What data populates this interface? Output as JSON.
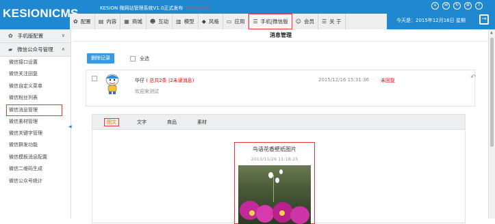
{
  "header": {
    "logo": "KESIONICMS",
    "system_name": "KESION 微网站管理系统V1.0正式发布",
    "system_highlight": "2015/2/15",
    "today": "今天是：2015年12月16日 星期",
    "nav": [
      {
        "icon": "gear-icon",
        "glyph": "✿",
        "label": "配置"
      },
      {
        "icon": "document-icon",
        "glyph": "▤",
        "label": "内容"
      },
      {
        "icon": "shop-icon",
        "glyph": "▦",
        "label": "商城"
      },
      {
        "icon": "people-icon",
        "glyph": "☻",
        "label": "互动"
      },
      {
        "icon": "grid-icon",
        "glyph": "▥",
        "label": "模型"
      },
      {
        "icon": "tag-icon",
        "glyph": "◆",
        "label": "风格"
      },
      {
        "icon": "monitor-icon",
        "glyph": "▭",
        "label": "应用"
      },
      {
        "icon": "menu-icon",
        "glyph": "☰",
        "label": "手机|微信版"
      },
      {
        "icon": "user-icon",
        "glyph": "☺",
        "label": "会员"
      },
      {
        "icon": "menu-icon",
        "glyph": "☰",
        "label": "关 于"
      }
    ],
    "active_nav": 7
  },
  "sidebar": {
    "sections": [
      {
        "icon": "gear-icon",
        "label": "手机版配置",
        "chevron": "∨"
      },
      {
        "icon": "chat-icon",
        "label": "微信公众号管理",
        "chevron": "∧"
      }
    ],
    "items": [
      "微信接口设置",
      "微信关注回复",
      "微信自定义菜单",
      "微信粉丝列表",
      "微信消息管理",
      "微信素材管理",
      "微信关键字管理",
      "微信群发功能",
      "微信模板消息配置",
      "微信二维码生成",
      "微信公众号统计"
    ],
    "active_item": 4
  },
  "main": {
    "page_title": "消息管理",
    "delete_button": "删除记录",
    "select_all": "全选",
    "message": {
      "user": "华仔",
      "count_text": "( 总共2条 |2未读消息)",
      "content": "欢迎来测试",
      "time": "2015/12/16 15:31:36",
      "status": "未回复"
    },
    "tabs": [
      "图文",
      "文字",
      "商品",
      "素材"
    ],
    "active_tab": 0,
    "card": {
      "title": "鸟语花香壁纸图片",
      "date": "2013/11/26 11:18:25"
    }
  }
}
